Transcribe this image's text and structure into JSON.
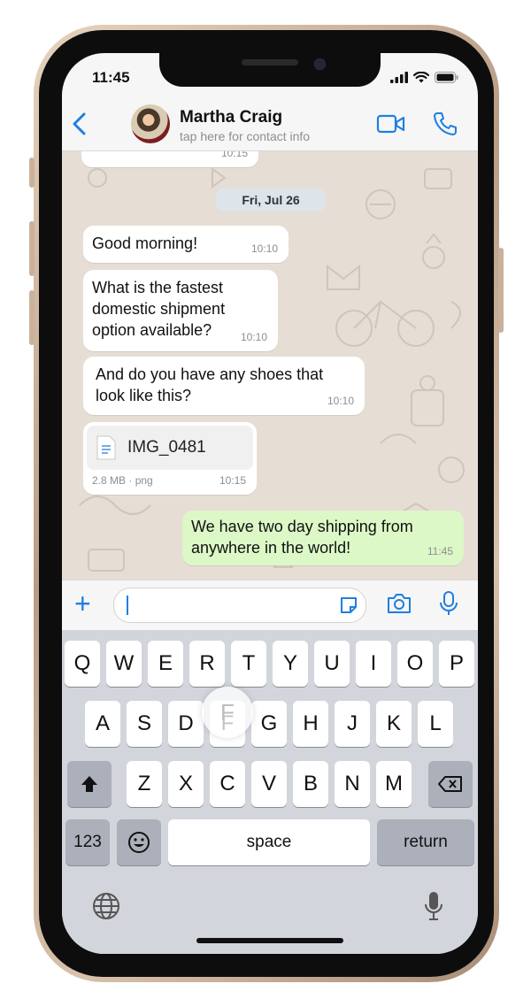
{
  "status_bar": {
    "time": "11:45"
  },
  "header": {
    "contact_name": "Martha Craig",
    "contact_subtitle": "tap here for contact info"
  },
  "chat": {
    "prev_time": "10:15",
    "date_pill": "Fri, Jul 26",
    "messages": [
      {
        "text": "Good morning!",
        "time": "10:10",
        "direction": "incoming"
      },
      {
        "text": "What is the fastest domestic shipment option available?",
        "time": "10:10",
        "direction": "incoming"
      },
      {
        "text": "And do you have any shoes that look like this?",
        "time": "10:10",
        "direction": "incoming"
      },
      {
        "text": "We have two day shipping from anywhere in the world!",
        "time": "11:45",
        "direction": "outgoing"
      }
    ],
    "file": {
      "name": "IMG_0481",
      "size": "2.8 MB",
      "type": "png",
      "time": "10:15"
    }
  },
  "input": {
    "placeholder": ""
  },
  "keyboard": {
    "row1": [
      "Q",
      "W",
      "E",
      "R",
      "T",
      "Y",
      "U",
      "I",
      "O",
      "P"
    ],
    "row2": [
      "A",
      "S",
      "D",
      "F",
      "G",
      "H",
      "J",
      "K",
      "L"
    ],
    "row3": [
      "Z",
      "X",
      "C",
      "V",
      "B",
      "N",
      "M"
    ],
    "numbers_label": "123",
    "space_label": "space",
    "return_label": "return",
    "pressed_key": "F"
  },
  "colors": {
    "accent": "#1f7fe0",
    "outgoing_bubble": "#dcf8c6",
    "chat_bg": "#e6ddd4"
  }
}
